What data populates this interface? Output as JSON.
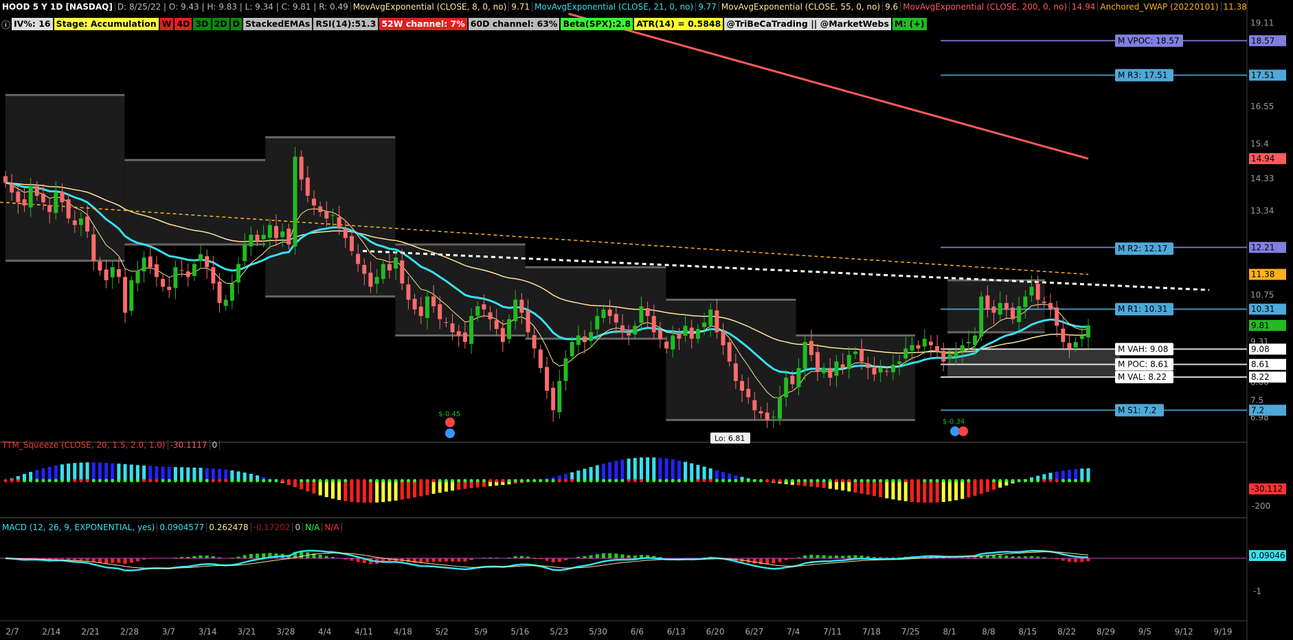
{
  "header": {
    "symbol": "HOOD 5 Y 1D [NASDAQ]",
    "ohlc": "D: 8/25/22 | O: 9.43 | H: 9.83 | L: 9.34 | C: 9.81 | R: 0.49",
    "studies": [
      {
        "label": "MovAvgExponential (CLOSE, 8, 0, no)",
        "value": "9.71",
        "color": "#ffe699"
      },
      {
        "label": "MovAvgExponential (CLOSE, 21, 0, no)",
        "value": "9.77",
        "color": "#37e0f0"
      },
      {
        "label": "MovAvgExponential (CLOSE, 55, 0, no)",
        "value": "9.6",
        "color": "#ffe699"
      },
      {
        "label": "MovAvgExponential (CLOSE, 200, 0, no)",
        "value": "14.94",
        "color": "#ff5b5b"
      },
      {
        "label": "Anchored_VWAP (20220101)",
        "value": "11.38",
        "color": "#ffb020"
      }
    ]
  },
  "labels": [
    {
      "text": "IV%: 16",
      "bg": "#dddddd",
      "fg": "#000000"
    },
    {
      "text": "Stage: Accumulation",
      "bg": "#ffff33",
      "fg": "#000000"
    },
    {
      "text": "W",
      "bg": "#e02020",
      "fg": "#000000"
    },
    {
      "text": "4D",
      "bg": "#e02020",
      "fg": "#000000"
    },
    {
      "text": "3D",
      "bg": "#0a8a0a",
      "fg": "#000000"
    },
    {
      "text": "2D",
      "bg": "#0a8a0a",
      "fg": "#000000"
    },
    {
      "text": "D",
      "bg": "#0a8a0a",
      "fg": "#000000"
    },
    {
      "text": "StackedEMAs",
      "bg": "#bbbbbb",
      "fg": "#000000"
    },
    {
      "text": "RSI(14):51.3",
      "bg": "#bbbbbb",
      "fg": "#000000"
    },
    {
      "text": "52W channel: 7%",
      "bg": "#e02020",
      "fg": "#ffffff"
    },
    {
      "text": "60D channel: 63%",
      "bg": "#bbbbbb",
      "fg": "#000000"
    },
    {
      "text": "Beta(SPX):2.8",
      "bg": "#33ff33",
      "fg": "#000000"
    },
    {
      "text": "ATR(14) = 0.5848",
      "bg": "#ffff33",
      "fg": "#000000"
    },
    {
      "text": "@TriBeCaTrading || @MarketWebs",
      "bg": "#dddddd",
      "fg": "#000000"
    },
    {
      "text": "M: (+)",
      "bg": "#22bb22",
      "fg": "#000000"
    }
  ],
  "squeeze": {
    "title": "TTM_Squeeze (CLOSE, 20, 1.5, 2.0, 1.0)",
    "value": "-30.1117",
    "value2": "0",
    "axis_label": "-30.112"
  },
  "macd": {
    "title": "MACD (12, 26, 9, EXPONENTIAL, yes)",
    "v1": "0.0904577",
    "v2": "0.262478",
    "v3": "-0.17202",
    "v4": "0",
    "v5": "N/A",
    "v6": "N/A",
    "axis_label": "0.09046"
  },
  "chart_data": {
    "type": "candlestick",
    "x_ticks": [
      "2/7",
      "2/14",
      "2/21",
      "2/28",
      "3/7",
      "3/14",
      "3/21",
      "3/28",
      "4/4",
      "4/11",
      "4/18",
      "5/2",
      "5/9",
      "5/16",
      "5/23",
      "5/30",
      "6/6",
      "6/13",
      "6/20",
      "6/27",
      "7/4",
      "7/11",
      "7/18",
      "7/25",
      "8/1",
      "8/8",
      "8/15",
      "8/22",
      "8/29",
      "9/5",
      "9/12",
      "9/19"
    ],
    "price_axis": {
      "min": 6.3,
      "max": 19.4,
      "ticks": [
        "19.11",
        "16.55",
        "15.4",
        "14.33",
        "13.34",
        "10.75",
        "9.31",
        "8.06",
        "7.5",
        "6.98"
      ]
    },
    "price_tags": [
      {
        "text": "18.57",
        "value": 18.57,
        "bg": "#8080e0"
      },
      {
        "text": "17.51",
        "value": 17.51,
        "bg": "#4fa8d8"
      },
      {
        "text": "14.94",
        "value": 14.94,
        "bg": "#ff5b5b"
      },
      {
        "text": "12.21",
        "value": 12.21,
        "bg": "#8080e0"
      },
      {
        "text": "11.38",
        "value": 11.38,
        "bg": "#ffb020"
      },
      {
        "text": "10.31",
        "value": 10.31,
        "bg": "#4fa8d8"
      },
      {
        "text": "9.81",
        "value": 9.81,
        "bg": "#22bb22"
      },
      {
        "text": "9.08",
        "value": 9.08,
        "bg": "#ffffff"
      },
      {
        "text": "8.61",
        "value": 8.61,
        "bg": "#ffffff"
      },
      {
        "text": "8.22",
        "value": 8.22,
        "bg": "#ffffff"
      },
      {
        "text": "7.2",
        "value": 7.2,
        "bg": "#4fa8d8"
      }
    ],
    "level_labels": [
      {
        "text": "M VPOC: 18.57",
        "value": 18.57,
        "bg": "#8080e0"
      },
      {
        "text": "M R3: 17.51",
        "value": 17.51,
        "bg": "#4fa8d8"
      },
      {
        "text": "M R2: 12.17",
        "value": 12.17,
        "bg": "#4fa8d8"
      },
      {
        "text": "M R1: 10.31",
        "value": 10.31,
        "bg": "#4fa8d8"
      },
      {
        "text": "M VAH: 9.08",
        "value": 9.08,
        "bg": "#ffffff"
      },
      {
        "text": "M POC: 8.61",
        "value": 8.61,
        "bg": "#ffffff"
      },
      {
        "text": "M VAL: 8.22",
        "value": 8.22,
        "bg": "#ffffff"
      },
      {
        "text": "M S1: 7.2",
        "value": 7.2,
        "bg": "#4fa8d8"
      }
    ],
    "annotations": [
      {
        "text": "Lo: 6.81",
        "value": 6.81
      },
      {
        "text": "$-0.45"
      },
      {
        "text": "$-0.34"
      }
    ],
    "closes": [
      14.2,
      13.9,
      13.6,
      13.5,
      14.1,
      13.8,
      13.6,
      13.3,
      13.9,
      13.6,
      13.1,
      12.9,
      13.1,
      12.7,
      11.8,
      11.5,
      11.2,
      11.6,
      11.3,
      10.2,
      11.2,
      11.5,
      11.9,
      11.6,
      11.3,
      11.0,
      10.9,
      11.6,
      11.5,
      11.3,
      11.7,
      12.0,
      11.6,
      11.1,
      10.5,
      10.6,
      11.1,
      11.7,
      12.3,
      12.6,
      12.4,
      12.6,
      12.9,
      12.5,
      12.7,
      12.3,
      15.0,
      14.3,
      13.8,
      13.5,
      13.3,
      13.1,
      13.2,
      12.8,
      12.5,
      12.1,
      11.7,
      11.4,
      11.0,
      11.3,
      11.7,
      11.5,
      11.9,
      11.1,
      10.6,
      10.3,
      10.1,
      10.7,
      10.4,
      10.0,
      9.9,
      9.6,
      9.5,
      9.3,
      10.1,
      10.4,
      10.3,
      10.0,
      9.7,
      9.3,
      10.0,
      10.6,
      10.2,
      9.6,
      9.1,
      8.5,
      7.8,
      7.2,
      8.1,
      8.8,
      9.3,
      9.5,
      9.3,
      9.6,
      10.1,
      10.3,
      10.1,
      9.9,
      9.6,
      9.5,
      9.8,
      10.4,
      10.1,
      9.6,
      9.4,
      9.1,
      9.5,
      9.4,
      9.8,
      9.4,
      9.7,
      9.9,
      10.3,
      9.6,
      9.2,
      8.7,
      8.1,
      7.8,
      7.6,
      7.2,
      7.1,
      6.9,
      7.0,
      7.6,
      8.2,
      8.0,
      8.5,
      9.3,
      8.9,
      8.4,
      8.5,
      8.2,
      8.7,
      8.5,
      8.9,
      9.0,
      8.7,
      8.5,
      8.3,
      8.5,
      8.4,
      8.6,
      8.7,
      9.1,
      9.2,
      9.1,
      9.4,
      9.2,
      9.0,
      8.7,
      8.9,
      9.0,
      9.2,
      9.3,
      9.5,
      10.7,
      10.3,
      10.2,
      10.5,
      10.3,
      10.0,
      10.4,
      10.7,
      11.0,
      10.6,
      10.5,
      10.3,
      9.8,
      9.3,
      9.1,
      9.3,
      9.5,
      9.81
    ]
  }
}
